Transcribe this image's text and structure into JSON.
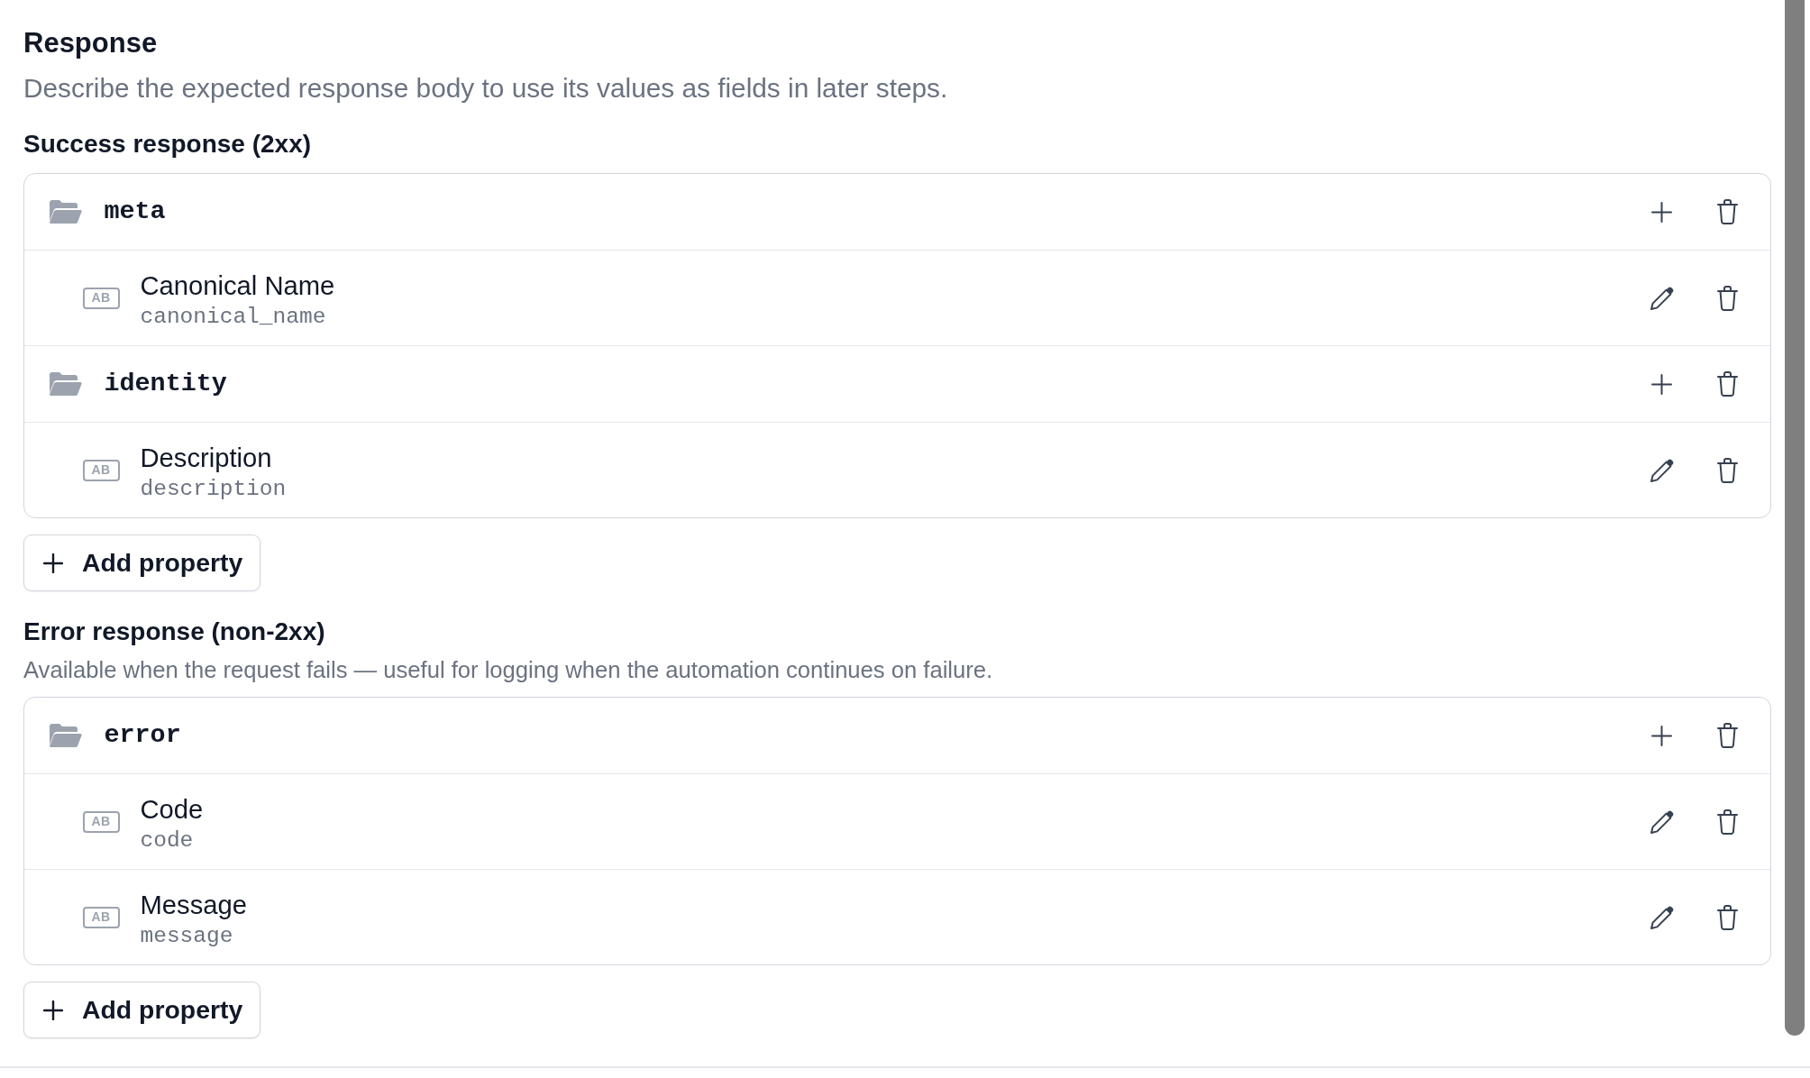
{
  "response": {
    "title": "Response",
    "description": "Describe the expected response body to use its values as fields in later steps."
  },
  "sections": [
    {
      "heading": "Success response (2xx)",
      "properties": [
        {
          "kind": "object",
          "name": "meta",
          "children": [
            {
              "kind": "field",
              "type_label": "AB",
              "label": "Canonical Name",
              "key": "canonical_name"
            }
          ]
        },
        {
          "kind": "object",
          "name": "identity",
          "children": [
            {
              "kind": "field",
              "type_label": "AB",
              "label": "Description",
              "key": "description"
            }
          ]
        }
      ],
      "add_button": "Add property"
    },
    {
      "heading": "Error response (non-2xx)",
      "description": "Available when the request fails — useful for logging when the automation continues on failure.",
      "properties": [
        {
          "kind": "object",
          "name": "error",
          "children": [
            {
              "kind": "field",
              "type_label": "AB",
              "label": "Code",
              "key": "code"
            },
            {
              "kind": "field",
              "type_label": "AB",
              "label": "Message",
              "key": "message"
            }
          ]
        }
      ],
      "add_button": "Add property"
    }
  ]
}
